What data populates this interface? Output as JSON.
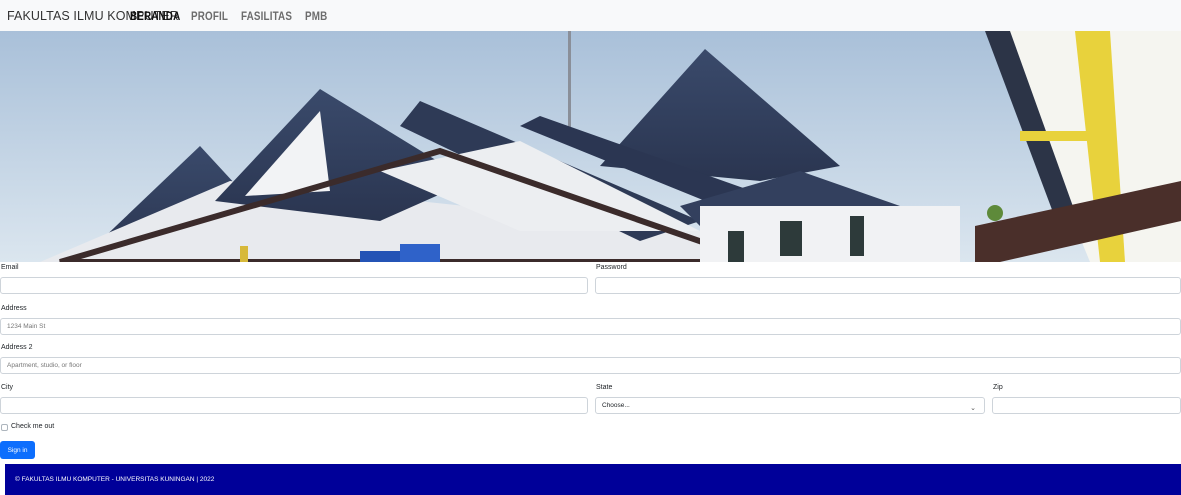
{
  "nav": {
    "brand": "FAKULTAS ILMU KOMPUTER",
    "items": [
      {
        "label": "BERANDA",
        "active": true
      },
      {
        "label": "PROFIL",
        "active": false
      },
      {
        "label": "FASILITAS",
        "active": false
      },
      {
        "label": "PMB",
        "active": false
      }
    ]
  },
  "hero": {
    "image": "campus-building-photo"
  },
  "form": {
    "email_label": "Email",
    "email_value": "",
    "password_label": "Password",
    "password_value": "",
    "address_label": "Address",
    "address_placeholder": "1234 Main St",
    "address2_label": "Address 2",
    "address2_placeholder": "Apartment, studio, or floor",
    "city_label": "City",
    "city_value": "",
    "state_label": "State",
    "state_selected": "Choose...",
    "zip_label": "Zip",
    "zip_value": "",
    "checkbox_label": "Check me out",
    "checkbox_checked": false,
    "submit_label": "Sign in"
  },
  "footer": {
    "text": "© FAKULTAS ILMU KOMPUTER - UNIVERSITAS KUNINGAN | 2022"
  },
  "colors": {
    "primary": "#0d6efd",
    "footer_bg": "#000099",
    "navbar_bg": "#f8f9fa"
  }
}
